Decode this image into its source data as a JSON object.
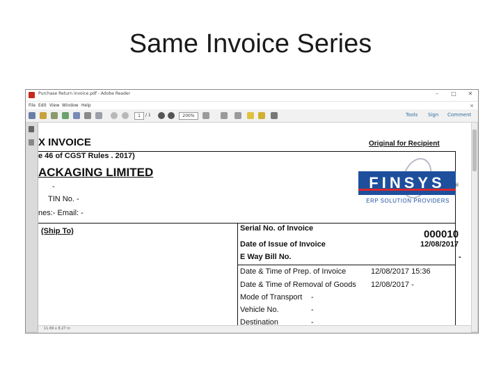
{
  "slide": {
    "title": "Same Invoice Series"
  },
  "window": {
    "title": "Purchase Return invoice.pdf - Adobe Reader",
    "controls": {
      "minimize": "–",
      "restore": "□",
      "close": "✕"
    }
  },
  "menu": {
    "file": "File",
    "edit": "Edit",
    "view": "View",
    "window": "Window",
    "help": "Help",
    "close": "×"
  },
  "toolbar": {
    "page_current": "1",
    "page_total": "/ 1",
    "zoom": "200%",
    "tools": "Tools",
    "sign": "Sign",
    "comment": "Comment"
  },
  "document": {
    "title": "X INVOICE",
    "rule": "e 46 of CGST Rules . 2017)",
    "company": "ACKAGING LIMITED",
    "addr_line1": "-",
    "addr_line2": "TIN No. -",
    "addr_line3": "nes:- Email: -",
    "original": "Original for Recipient",
    "logo": {
      "name": "FINSYS",
      "reg": "®",
      "tagline": "ERP SOLUTION PROVIDERS"
    },
    "ship_to": "(Ship To)",
    "invoice": {
      "serial_label": "Serial No. of Invoice",
      "serial_value": "000010",
      "issue_label": "Date of Issue of Invoice",
      "issue_value": "12/08/2017",
      "eway_label": "E Way Bill No.",
      "eway_value": "-"
    },
    "details": [
      {
        "label": "Date & Time of Prep. of Invoice",
        "value": "12/08/2017 15:36"
      },
      {
        "label": "Date & Time of Removal of Goods",
        "value": "12/08/2017 -"
      },
      {
        "label": "Mode of Transport",
        "value": "-"
      },
      {
        "label": "Vehicle No.",
        "value": "-"
      },
      {
        "label": "Destination",
        "value": "-"
      }
    ]
  },
  "status": {
    "size": "11.69 x 8.27 in"
  },
  "colors": {
    "finsys_blue": "#1d4f9c",
    "finsys_red": "#d8272d",
    "link_blue": "#2d6ea0"
  }
}
